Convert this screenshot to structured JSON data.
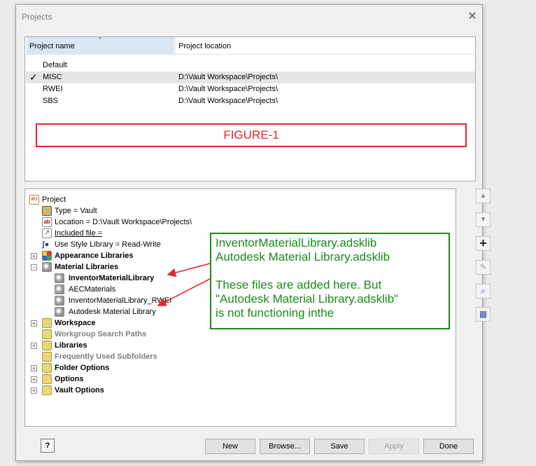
{
  "window": {
    "title": "Projects",
    "close_glyph": "✕"
  },
  "projects": {
    "columns": [
      "Project name",
      "Project location"
    ],
    "rows": [
      {
        "name": "Default",
        "location": "",
        "active": false
      },
      {
        "name": "MISC",
        "location": "D:\\Vault Workspace\\Projects\\",
        "active": true
      },
      {
        "name": "RWEI",
        "location": "D:\\Vault Workspace\\Projects\\",
        "active": false
      },
      {
        "name": "SBS",
        "location": "D:\\Vault Workspace\\Projects\\",
        "active": false
      }
    ],
    "active_mark": "✓",
    "figure_label": "FIGURE-1"
  },
  "tree": {
    "root": "Project",
    "type": "Type = Vault",
    "location": "Location = D:\\Vault Workspace\\Projects\\",
    "included": "Included file = ",
    "style": "Use Style Library = Read-Write",
    "appearance": "Appearance Libraries",
    "material": "Material Libraries",
    "materials": [
      "InventorMaterialLibrary",
      "AECMaterials",
      "InventorMaterialLibrary_RWEI",
      "Autodesk Material Library"
    ],
    "workspace": "Workspace",
    "workgroup": "Workgroup Search Paths",
    "libraries": "Libraries",
    "frequent": "Frequently Used Subfolders",
    "folder_options": "Folder Options",
    "options": "Options",
    "vault_options": "Vault Options"
  },
  "annotation": {
    "lines": [
      "InventorMaterialLibrary.adsklib",
      "Autodesk Material Library.adsklib",
      "",
      "These files are added here. But",
      "\"Autodesk Material Library.adsklib\"",
      "is not functioning inthe"
    ],
    "color": "#1a8a1a"
  },
  "buttons": {
    "new": "New",
    "browse": "Browse...",
    "save": "Save",
    "apply": "Apply",
    "done": "Done",
    "help": "?"
  },
  "colors": {
    "accent_red": "#e3262c",
    "header_sel": "#d9e7f5"
  }
}
